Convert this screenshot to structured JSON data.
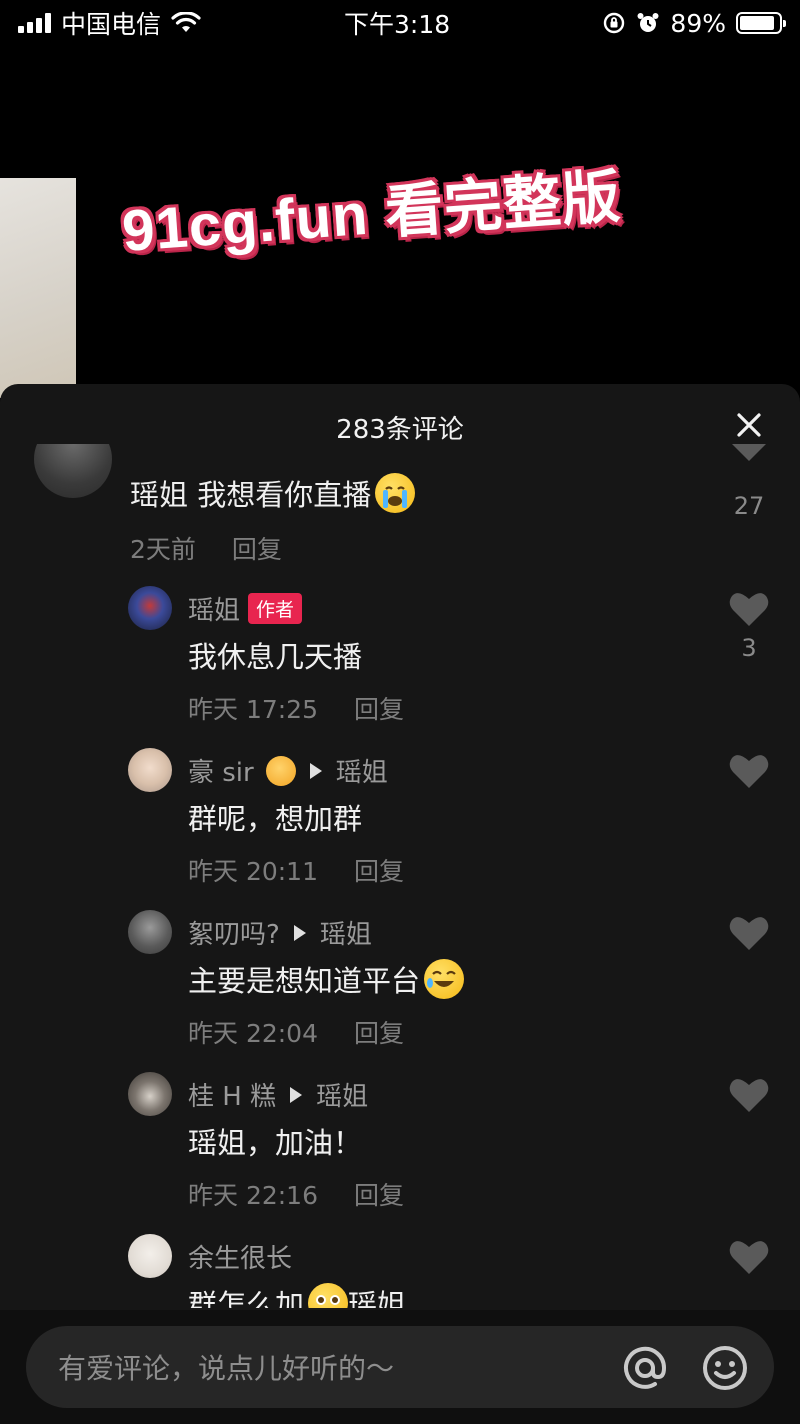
{
  "status_bar": {
    "carrier": "中国电信",
    "time": "下午3:18",
    "battery": "89%",
    "battery_level": 0.89
  },
  "video": {
    "overlay_text": "91cg.fun 看完整版"
  },
  "comments_panel": {
    "title": "283条评论",
    "comments": [
      {
        "text": "瑶姐 我想看你直播",
        "time": "2天前",
        "reply": "回复",
        "likes": "27"
      },
      {
        "name": "瑶姐",
        "badge": "作者",
        "text": "我休息几天播",
        "time": "昨天 17:25",
        "reply": "回复",
        "likes": "3"
      },
      {
        "name": "豪 sir",
        "reply_to": "瑶姐",
        "text": "群呢，想加群",
        "time": "昨天 20:11",
        "reply": "回复"
      },
      {
        "name": "絮叨吗?",
        "reply_to": "瑶姐",
        "text": "主要是想知道平台",
        "time": "昨天 22:04",
        "reply": "回复"
      },
      {
        "name": "桂 H 糕",
        "reply_to": "瑶姐",
        "text": "瑶姐，加油！",
        "time": "昨天 22:16",
        "reply": "回复"
      },
      {
        "name": "余生很长",
        "text_before": "群怎么加",
        "text_after": "瑶姐"
      }
    ]
  },
  "input": {
    "placeholder": "有爱评论，说点儿好听的～"
  },
  "colors": {
    "panel_bg": "#161616",
    "author_badge": "#e8254f",
    "overlay_outline": "#d2355a"
  }
}
